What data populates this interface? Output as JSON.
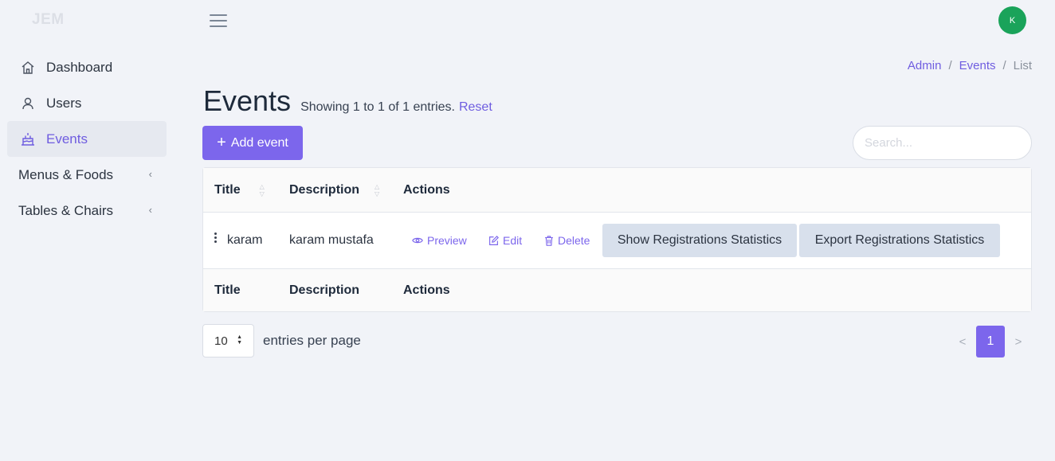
{
  "brand": "JEM",
  "sidebar": {
    "items": [
      {
        "label": "Dashboard",
        "icon": "home-icon"
      },
      {
        "label": "Users",
        "icon": "user-icon"
      },
      {
        "label": "Events",
        "icon": "cake-icon",
        "active": true
      },
      {
        "label": "Menus & Foods",
        "caret": "‹"
      },
      {
        "label": "Tables & Chairs",
        "caret": "‹"
      }
    ]
  },
  "header": {
    "avatar_initial": "K",
    "avatar_color": "#1aa35a"
  },
  "breadcrumb": {
    "items": [
      "Admin",
      "Events",
      "List"
    ],
    "separator": "/"
  },
  "page": {
    "title": "Events",
    "showing": "Showing 1 to 1 of 1 entries.",
    "reset_label": "Reset",
    "add_button_label": "Add event",
    "search_placeholder": "Search..."
  },
  "table": {
    "columns": [
      "Title",
      "Description",
      "Actions"
    ],
    "rows": [
      {
        "title": "karam",
        "description": "karam mustafa",
        "actions": {
          "preview": "Preview",
          "edit": "Edit",
          "delete": "Delete",
          "show_stats": "Show Registrations Statistics",
          "export_stats": "Export Registrations Statistics"
        }
      }
    ]
  },
  "footer": {
    "per_page_value": "10",
    "per_page_label": "entries per page",
    "prev": "<",
    "next": ">",
    "current_page": "1"
  },
  "colors": {
    "accent": "#7c66ec",
    "background": "#f1f3f8"
  }
}
